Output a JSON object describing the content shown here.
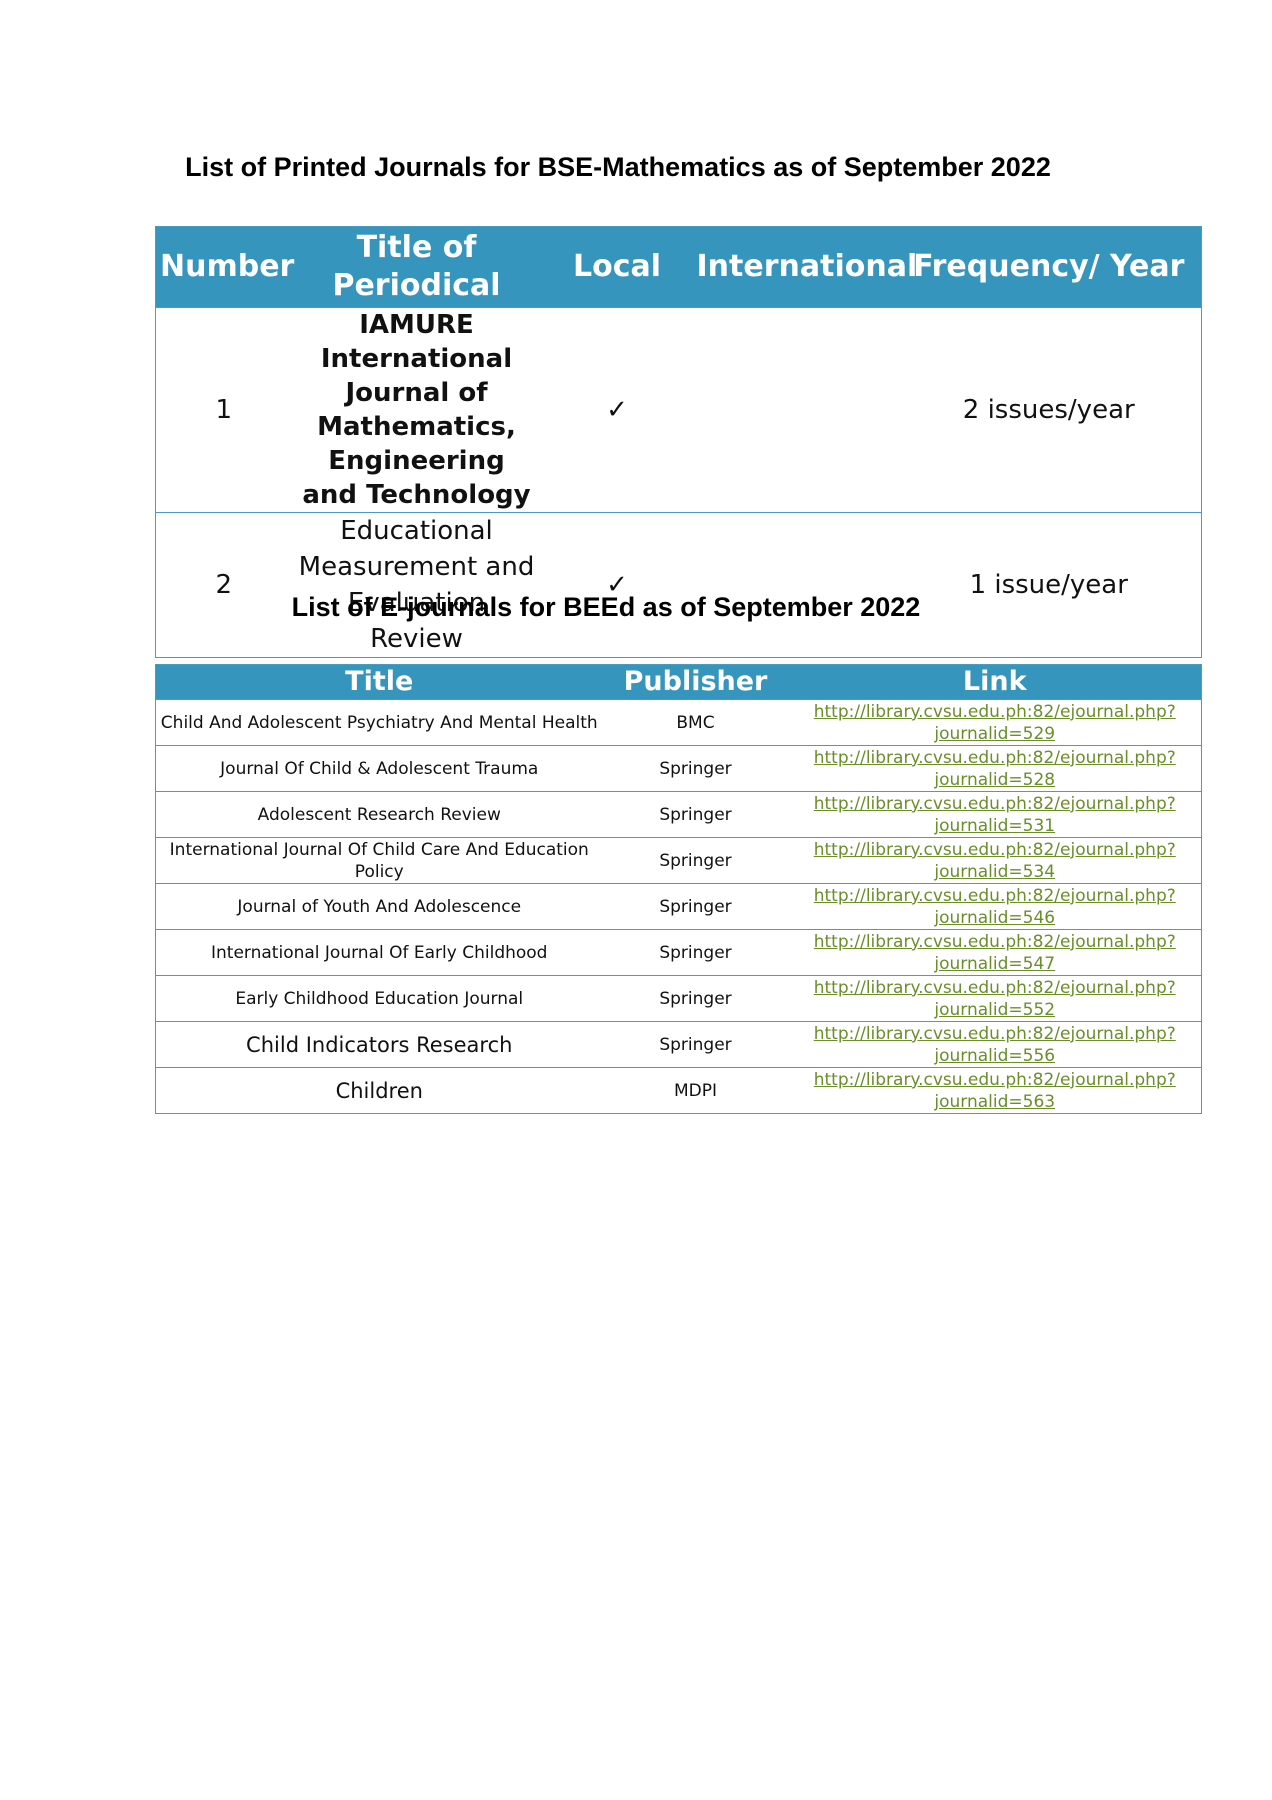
{
  "printed": {
    "title": "List of Printed Journals for BSE-Mathematics as of September 2022",
    "headers": [
      "Number",
      "Title of Periodical",
      "Local",
      "International",
      "Frequency/ Year"
    ],
    "rows": [
      {
        "number": "1",
        "title": "IAMURE International Journal of Mathematics, Engineering and Technology",
        "local": "✓",
        "international": "",
        "frequency": "2 issues/year"
      },
      {
        "number": "2",
        "title": "Educational Measurement and Evaluation Review",
        "local": "✓",
        "international": "",
        "frequency": "1 issue/year"
      }
    ]
  },
  "ejournals": {
    "title": "List of E-journals for BEEd as of September 2022",
    "headers": [
      "Title",
      "Publisher",
      "Link"
    ],
    "rows": [
      {
        "title": "Child And Adolescent Psychiatry And Mental Health",
        "publisher": "BMC",
        "link": "http://library.cvsu.edu.ph:82/ejournal.php?journalid=529"
      },
      {
        "title": "Journal Of Child & Adolescent Trauma",
        "publisher": "Springer",
        "link": "http://library.cvsu.edu.ph:82/ejournal.php?journalid=528"
      },
      {
        "title": "Adolescent Research Review",
        "publisher": "Springer",
        "link": "http://library.cvsu.edu.ph:82/ejournal.php?journalid=531"
      },
      {
        "title": "International Journal Of Child Care And Education Policy",
        "publisher": "Springer",
        "link": "http://library.cvsu.edu.ph:82/ejournal.php?journalid=534"
      },
      {
        "title": "Journal of Youth And Adolescence",
        "publisher": "Springer",
        "link": "http://library.cvsu.edu.ph:82/ejournal.php?journalid=546"
      },
      {
        "title": "International Journal Of Early Childhood",
        "publisher": "Springer",
        "link": "http://library.cvsu.edu.ph:82/ejournal.php?journalid=547"
      },
      {
        "title": "Early Childhood Education Journal",
        "publisher": "Springer",
        "link": "http://library.cvsu.edu.ph:82/ejournal.php?journalid=552"
      },
      {
        "title": "Child Indicators Research",
        "publisher": "Springer",
        "link": "http://library.cvsu.edu.ph:82/ejournal.php?journalid=556"
      },
      {
        "title": "Children",
        "publisher": "MDPI",
        "link": "http://library.cvsu.edu.ph:82/ejournal.php?journalid=563"
      }
    ]
  },
  "colors": {
    "header_bg": "#3595bd",
    "link": "#6a8f28",
    "border": "#4a9bc0"
  }
}
